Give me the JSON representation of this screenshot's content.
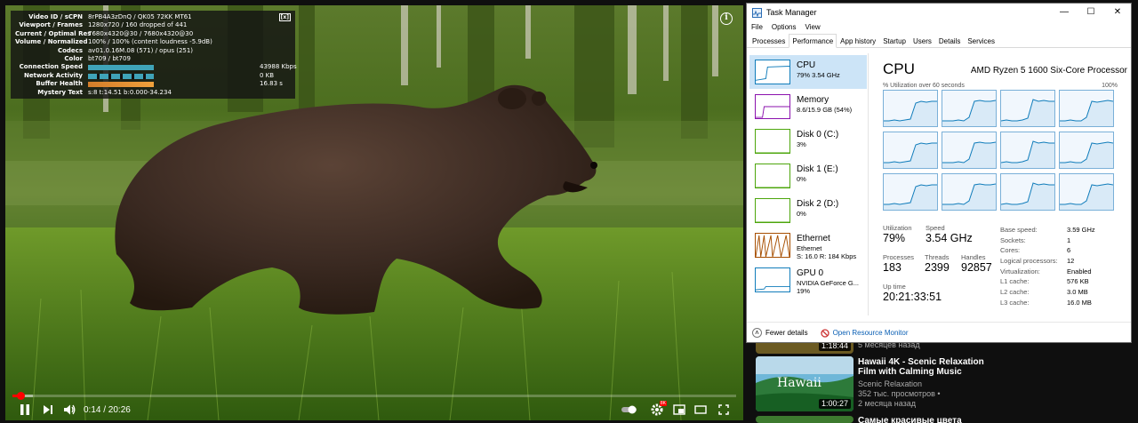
{
  "stats": {
    "rows": [
      {
        "k": "Video ID / sCPN",
        "v": "8rPB4A3zDnQ / QK05 72KK MT61"
      },
      {
        "k": "Viewport / Frames",
        "v": "1280x720 / 160 dropped of 441"
      },
      {
        "k": "Current / Optimal Res",
        "v": "7680x4320@30 / 7680x4320@30"
      },
      {
        "k": "Volume / Normalized",
        "v": "100% / 100% (content loudness -5.9dB)"
      },
      {
        "k": "Codecs",
        "v": "av01.0.16M.08 (571) / opus (251)"
      },
      {
        "k": "Color",
        "v": "bt709 / bt709"
      },
      {
        "k": "Connection Speed",
        "v": "43988 Kbps"
      },
      {
        "k": "Network Activity",
        "v": "0 KB"
      },
      {
        "k": "Buffer Health",
        "v": "16.83 s"
      },
      {
        "k": "Mystery Text",
        "v": "s:8 t:14.51 b:0.000-34.234"
      }
    ],
    "close": "[x]"
  },
  "player": {
    "current_time": "0:14",
    "duration": "20:26",
    "time_text": "0:14 / 20:26",
    "progress_fraction": 0.0114,
    "loaded_fraction": 0.028,
    "info_glyph": "i",
    "icons": [
      "play-pause-icon",
      "next-icon",
      "volume-icon",
      "autoplay-toggle-icon",
      "settings-gear-icon",
      "miniplayer-icon",
      "theater-mode-icon",
      "fullscreen-icon"
    ],
    "settings_badge": "8K"
  },
  "recommendations": [
    {
      "title": "",
      "channel": "",
      "views": "",
      "age": "5 месяцев назад",
      "duration": "1:18:44"
    },
    {
      "title": "Hawaii 4K - Scenic Relaxation Film with Calming Music",
      "channel": "Scenic Relaxation",
      "views": "352 тыс. просмотров •",
      "age": "2 месяца назад",
      "duration": "1:00:27",
      "thumb_text": "Hawaii"
    },
    {
      "title": "Самые красивые цвета",
      "channel": "",
      "views": "",
      "age": "",
      "duration": ""
    }
  ],
  "task_manager": {
    "title": "Task Manager",
    "window_buttons": [
      "—",
      "☐",
      "✕"
    ],
    "menu": [
      "File",
      "Options",
      "View"
    ],
    "tabs": [
      "Processes",
      "Performance",
      "App history",
      "Startup",
      "Users",
      "Details",
      "Services"
    ],
    "active_tab": "Performance",
    "resources": [
      {
        "name": "CPU",
        "sub1": "79% 3.54 GHz",
        "sub2": "",
        "color": "#117dbb",
        "active": true
      },
      {
        "name": "Memory",
        "sub1": "8.6/15.9 GB (54%)",
        "sub2": "",
        "color": "#8b12ae"
      },
      {
        "name": "Disk 0 (C:)",
        "sub1": "3%",
        "sub2": "",
        "color": "#4da60c"
      },
      {
        "name": "Disk 1 (E:)",
        "sub1": "0%",
        "sub2": "",
        "color": "#4da60c"
      },
      {
        "name": "Disk 2 (D:)",
        "sub1": "0%",
        "sub2": "",
        "color": "#4da60c"
      },
      {
        "name": "Ethernet",
        "sub1": "Ethernet",
        "sub2": "S: 16.0  R: 184 Kbps",
        "color": "#a74f01"
      },
      {
        "name": "GPU 0",
        "sub1": "NVIDIA GeForce G...",
        "sub2": "19%",
        "color": "#117dbb"
      }
    ],
    "cpu": {
      "heading": "CPU",
      "processor": "AMD Ryzen 5 1600 Six-Core Processor",
      "graph_label": "% Utilization over 60 seconds",
      "graph_max": "100%",
      "utilization_label": "Utilization",
      "utilization": "79%",
      "speed_label": "Speed",
      "speed": "3.54 GHz",
      "processes_label": "Processes",
      "processes": "183",
      "threads_label": "Threads",
      "threads": "2399",
      "handles_label": "Handles",
      "handles": "92857",
      "uptime_label": "Up time",
      "uptime": "20:21:33:51",
      "specs": [
        {
          "k": "Base speed:",
          "v": "3.59 GHz"
        },
        {
          "k": "Sockets:",
          "v": "1"
        },
        {
          "k": "Cores:",
          "v": "6"
        },
        {
          "k": "Logical processors:",
          "v": "12"
        },
        {
          "k": "Virtualization:",
          "v": "Enabled"
        },
        {
          "k": "L1 cache:",
          "v": "576 KB"
        },
        {
          "k": "L2 cache:",
          "v": "3.0 MB"
        },
        {
          "k": "L3 cache:",
          "v": "16.0 MB"
        }
      ]
    },
    "fewer_details": "Fewer details",
    "open_resource_monitor": "Open Resource Monitor"
  }
}
